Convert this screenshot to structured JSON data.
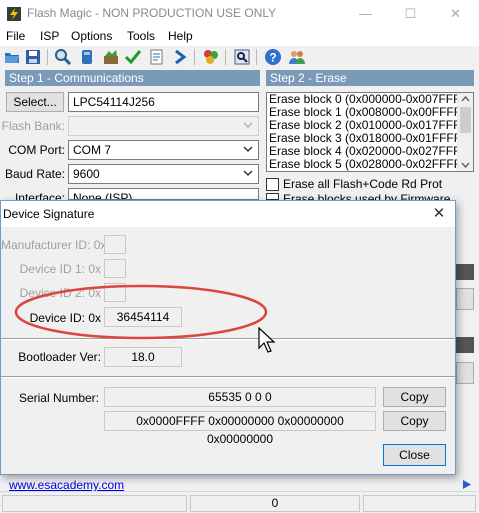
{
  "window": {
    "title": "Flash Magic - NON PRODUCTION USE ONLY",
    "minimize_glyph": "—",
    "maximize_glyph": "☐",
    "close_glyph": "✕"
  },
  "menu": [
    "File",
    "ISP",
    "Options",
    "Tools",
    "Help"
  ],
  "toolbar": {
    "icons": [
      "open-icon",
      "save-icon",
      "search-icon",
      "erase-icon",
      "settings-icon",
      "verify-icon",
      "start-icon",
      "next-icon",
      "compare-icon",
      "find-icon",
      "help-icon",
      "users-icon"
    ]
  },
  "step1": {
    "heading": "Step 1 - Communications",
    "select_label": "Select...",
    "device_value": "LPC54114J256",
    "flash_bank_label": "Flash Bank:",
    "flash_bank_value": "",
    "com_port_label": "COM Port:",
    "com_port_value": "COM 7",
    "baud_rate_label": "Baud Rate:",
    "baud_rate_value": "9600",
    "interface_label": "Interface:",
    "interface_value": "None (ISP)"
  },
  "step2": {
    "heading": "Step 2 - Erase",
    "erase_blocks": [
      "Erase block 0 (0x000000-0x007FFF)",
      "Erase block 1 (0x008000-0x00FFFF)",
      "Erase block 2 (0x010000-0x017FFF)",
      "Erase block 3 (0x018000-0x01FFFF)",
      "Erase block 4 (0x020000-0x027FFF)",
      "Erase block 5 (0x028000-0x02FFFF)"
    ],
    "erase_all_label": "Erase all Flash+Code Rd Prot",
    "erase_used_label": "Erase blocks used by Firmware"
  },
  "dialog": {
    "title": "Device Signature",
    "manufacturer_label": "Manufacturer ID: 0x",
    "manufacturer_value": "",
    "device_id1_label": "Device ID 1: 0x",
    "device_id1_value": "",
    "device_id2_label": "Device ID 2: 0x",
    "device_id2_value": "",
    "device_id_label": "Device ID: 0x",
    "device_id_value": "36454114",
    "bootloader_label": "Bootloader Ver:",
    "bootloader_value": "18.0",
    "serial_label": "Serial Number:",
    "serial_value": "65535 0 0 0",
    "serial_hex_value": "0x0000FFFF 0x00000000 0x00000000 0x00000000",
    "copy_label": "Copy",
    "copy2_label": "Copy",
    "close_label": "Close"
  },
  "footer": {
    "link": "www.esacademy.com",
    "status_value": "0"
  },
  "colors": {
    "section_header": "#7a9ab8",
    "highlight_ellipse": "#d9473f",
    "link": "#0000ee",
    "dialog_border": "#6f9bd1"
  }
}
